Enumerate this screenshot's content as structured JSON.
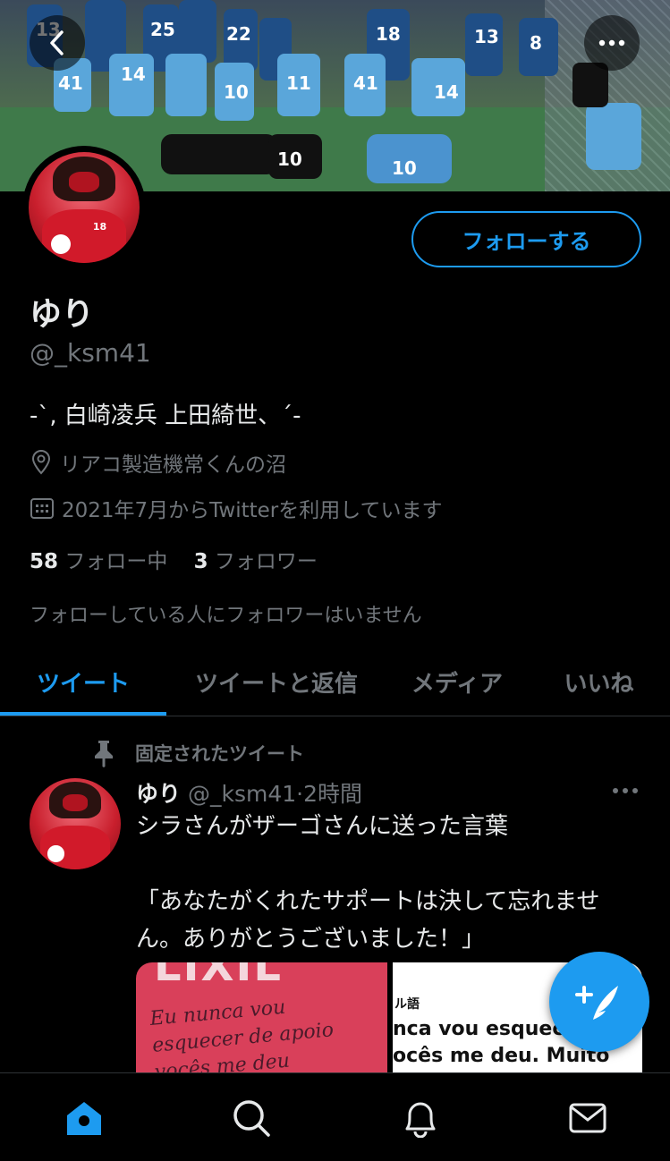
{
  "header": {
    "back_icon": "chevron-left-icon",
    "more_icon": "more-dots-icon"
  },
  "profile": {
    "follow_label": "フォローする",
    "name": "ゆり",
    "handle": "@_ksm41",
    "bio": "-`, 白崎凌兵 上田綺世、´-",
    "location": "リアコ製造機常くんの沼",
    "joined": "2021年7月からTwitterを利用しています",
    "following_count": "58",
    "following_label": "フォロー中",
    "followers_count": "3",
    "followers_label": "フォロワー",
    "no_mutual": "フォローしている人にフォロワーはいません"
  },
  "tabs": [
    {
      "label": "ツイート",
      "active": true
    },
    {
      "label": "ツイートと返信",
      "active": false
    },
    {
      "label": "メディア",
      "active": false
    },
    {
      "label": "いいね",
      "active": false
    }
  ],
  "tweet": {
    "pinned_label": "固定されたツイート",
    "author_name": "ゆり",
    "author_handle": "@_ksm41",
    "time": "2時間",
    "line1": "シラさんがザーゴさんに送った言葉",
    "line2": "「あなたがくれたサポートは決して忘れませ",
    "line3": "ん。ありがとうございました！」",
    "media_left_logo": "LIXIL",
    "media_left_hand1": "Eu nunca vou",
    "media_left_hand2": "esquecer de apoio",
    "media_left_hand3": "vocês me deu",
    "media_right_label": "ル語",
    "media_right_line1": "nca vou esquecer",
    "media_right_line2": "ocês me deu.  Muito"
  },
  "bottom_nav": [
    "home-icon",
    "search-icon",
    "notifications-icon",
    "messages-icon"
  ],
  "colors": {
    "accent": "#1d9bf0",
    "background": "#000000",
    "muted": "#71767b"
  }
}
